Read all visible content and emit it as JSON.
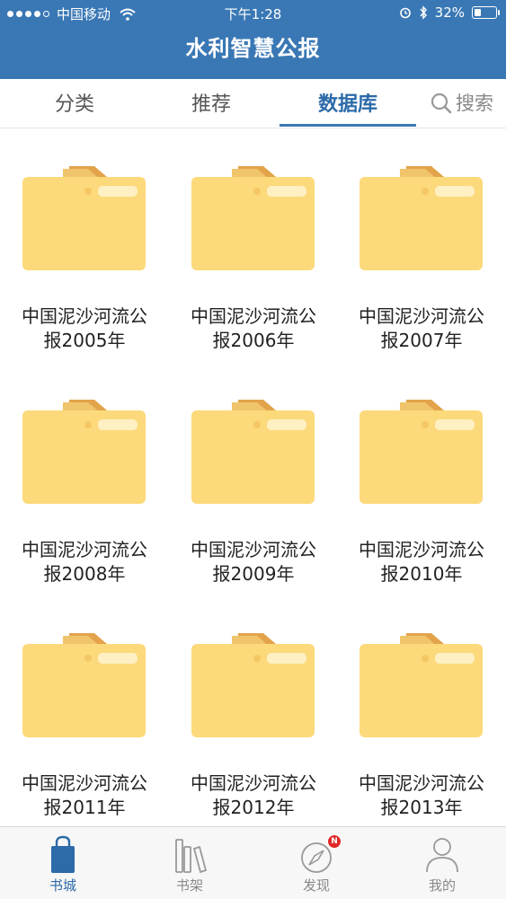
{
  "status_bar": {
    "carrier": "中国移动",
    "time": "下午1:28",
    "battery": "32%",
    "battery_level": 0.32
  },
  "header": {
    "title": "水利智慧公报"
  },
  "tabs": [
    {
      "label": "分类",
      "active": false
    },
    {
      "label": "推荐",
      "active": false
    },
    {
      "label": "数据库",
      "active": true
    }
  ],
  "search": {
    "label": "搜索",
    "icon": "search-icon"
  },
  "items": [
    {
      "line1": "中国泥沙河流公",
      "line2": "报2005年"
    },
    {
      "line1": "中国泥沙河流公",
      "line2": "报2006年"
    },
    {
      "line1": "中国泥沙河流公",
      "line2": "报2007年"
    },
    {
      "line1": "中国泥沙河流公",
      "line2": "报2008年"
    },
    {
      "line1": "中国泥沙河流公",
      "line2": "报2009年"
    },
    {
      "line1": "中国泥沙河流公",
      "line2": "报2010年"
    },
    {
      "line1": "中国泥沙河流公",
      "line2": "报2011年"
    },
    {
      "line1": "中国泥沙河流公",
      "line2": "报2012年"
    },
    {
      "line1": "中国泥沙河流公",
      "line2": "报2013年"
    }
  ],
  "tabbar": [
    {
      "label": "书城",
      "icon": "shopping-bag-icon",
      "active": true
    },
    {
      "label": "书架",
      "icon": "bookshelf-icon",
      "active": false
    },
    {
      "label": "发现",
      "icon": "compass-icon",
      "active": false,
      "badge": "N"
    },
    {
      "label": "我的",
      "icon": "user-icon",
      "active": false
    }
  ],
  "colors": {
    "header_bg": "#3a78b5",
    "accent": "#2c6aa8",
    "folder": "#fcd97a",
    "folder_back": "#e7b45a",
    "badge": "#e02828"
  }
}
